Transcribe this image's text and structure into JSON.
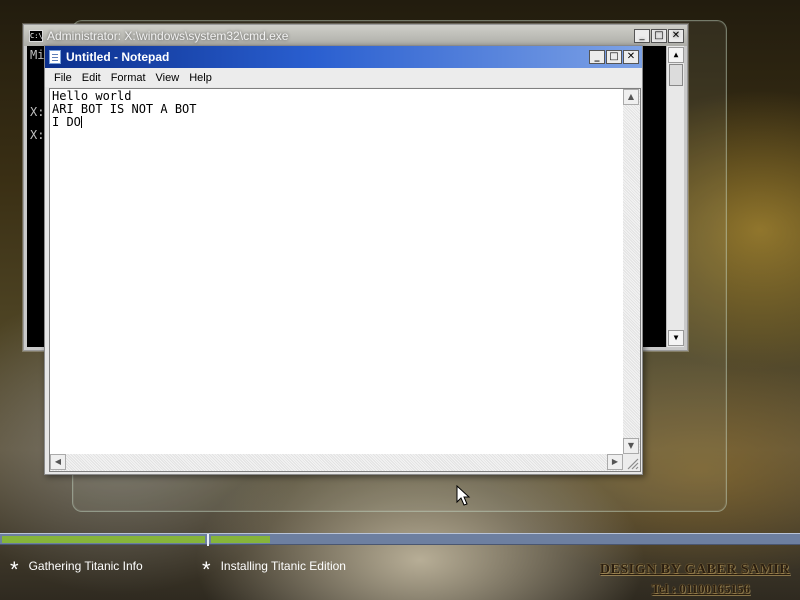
{
  "cmd_window": {
    "title": "Administrator: X:\\windows\\system32\\cmd.exe",
    "icon_label": "C:\\",
    "lines": [
      "Mi",
      "X:",
      "X:"
    ],
    "buttons": {
      "minimize": "_",
      "maximize": "□",
      "close": "✕"
    }
  },
  "notepad": {
    "title": "Untitled - Notepad",
    "buttons": {
      "minimize": "_",
      "maximize": "□",
      "close": "✕"
    },
    "menu": [
      "File",
      "Edit",
      "Format",
      "View",
      "Help"
    ],
    "text_lines": [
      "Hello world",
      "ARI BOT IS NOT A BOT",
      "I DO"
    ]
  },
  "progress": {
    "segment1_fraction": 1.0,
    "segment2_fraction": 0.1
  },
  "status": {
    "step1": "Gathering Titanic Info",
    "step2": "Installing Titanic Edition",
    "bullet": "*"
  },
  "credit": {
    "line1": "DESIGN BY GABER SAMIR",
    "line2": "Tel : 01100165156"
  },
  "colors": {
    "progress_fill": "#86b43a",
    "progress_track": "#6d7fa0",
    "notepad_title_start": "#0b2f8c",
    "notepad_title_end": "#7da2e6"
  },
  "icons": {
    "cmd": "cmd-icon",
    "notepad": "notepad-icon",
    "cursor": "mouse-cursor-icon"
  }
}
